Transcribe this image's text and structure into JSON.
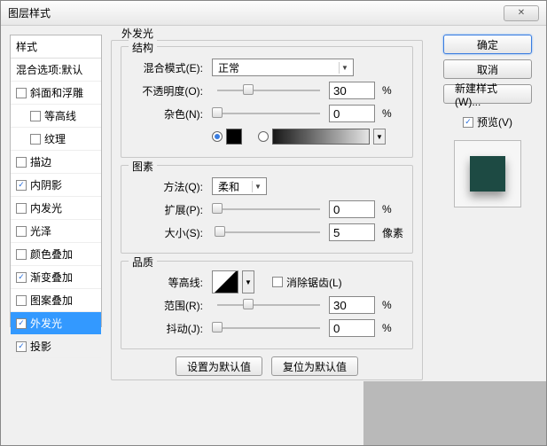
{
  "window": {
    "title": "图层样式"
  },
  "styles": {
    "header": "样式",
    "blendDefault": "混合选项:默认",
    "items": [
      {
        "label": "斜面和浮雕",
        "checked": false
      },
      {
        "label": "等高线",
        "checked": false,
        "indent": true
      },
      {
        "label": "纹理",
        "checked": false,
        "indent": true
      },
      {
        "label": "描边",
        "checked": false
      },
      {
        "label": "内阴影",
        "checked": true
      },
      {
        "label": "内发光",
        "checked": false
      },
      {
        "label": "光泽",
        "checked": false
      },
      {
        "label": "颜色叠加",
        "checked": false
      },
      {
        "label": "渐变叠加",
        "checked": true
      },
      {
        "label": "图案叠加",
        "checked": false
      },
      {
        "label": "外发光",
        "checked": true,
        "selected": true
      },
      {
        "label": "投影",
        "checked": true
      }
    ]
  },
  "panel": {
    "title": "外发光",
    "structure": {
      "legend": "结构",
      "blendMode": {
        "label": "混合模式(E):",
        "value": "正常"
      },
      "opacity": {
        "label": "不透明度(O):",
        "value": "30",
        "unit": "%",
        "pos": 30
      },
      "noise": {
        "label": "杂色(N):",
        "value": "0",
        "unit": "%",
        "pos": 0
      },
      "solidColor": "#000000"
    },
    "element": {
      "legend": "图素",
      "method": {
        "label": "方法(Q):",
        "value": "柔和"
      },
      "spread": {
        "label": "扩展(P):",
        "value": "0",
        "unit": "%",
        "pos": 0
      },
      "size": {
        "label": "大小(S):",
        "value": "5",
        "unit": "像素",
        "pos": 3
      }
    },
    "quality": {
      "legend": "品质",
      "contour": {
        "label": "等高线:"
      },
      "antialias": {
        "label": "消除锯齿(L)",
        "checked": false
      },
      "range": {
        "label": "范围(R):",
        "value": "30",
        "unit": "%",
        "pos": 30
      },
      "jitter": {
        "label": "抖动(J):",
        "value": "0",
        "unit": "%",
        "pos": 0
      }
    },
    "buttons": {
      "setDefault": "设置为默认值",
      "resetDefault": "复位为默认值"
    }
  },
  "right": {
    "ok": "确定",
    "cancel": "取消",
    "newStyle": "新建样式(W)...",
    "preview": {
      "label": "预览(V)",
      "checked": true
    }
  }
}
